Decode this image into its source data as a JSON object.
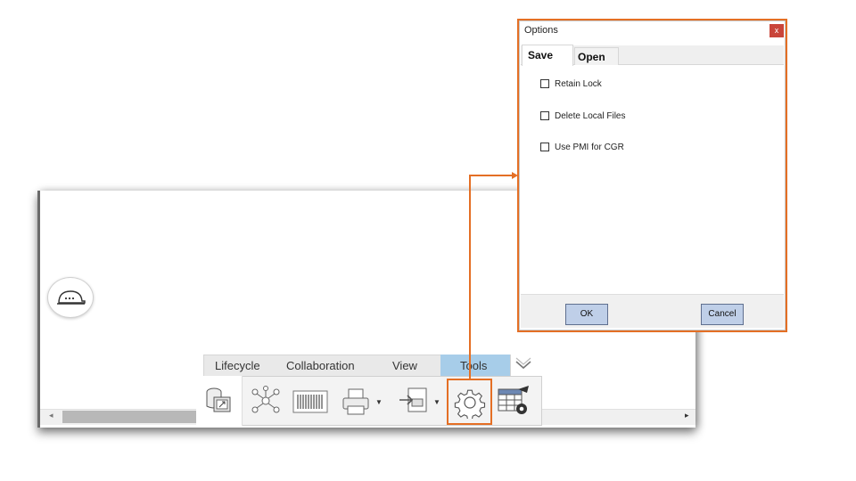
{
  "ribbon": {
    "tabs": [
      {
        "label": "Lifecycle"
      },
      {
        "label": "Collaboration"
      },
      {
        "label": "View"
      },
      {
        "label": "Tools"
      }
    ],
    "active_tab": "Tools",
    "icons": [
      "content-icon",
      "network-icon",
      "barcode-icon",
      "printer-icon",
      "export-icon",
      "gear-icon",
      "table-settings-icon"
    ]
  },
  "options_dialog": {
    "title": "Options",
    "close_label": "x",
    "tabs": [
      {
        "label": "Save"
      },
      {
        "label": "Open"
      }
    ],
    "active_tab": "Save",
    "options": [
      {
        "label": "Retain Lock",
        "checked": false
      },
      {
        "label": "Delete Local Files",
        "checked": false
      },
      {
        "label": "Use PMI for CGR",
        "checked": false
      }
    ],
    "ok_label": "OK",
    "cancel_label": "Cancel"
  },
  "colors": {
    "highlight": "#e46f25",
    "active_tab": "#a7cde9",
    "button": "#bfcfe8"
  }
}
